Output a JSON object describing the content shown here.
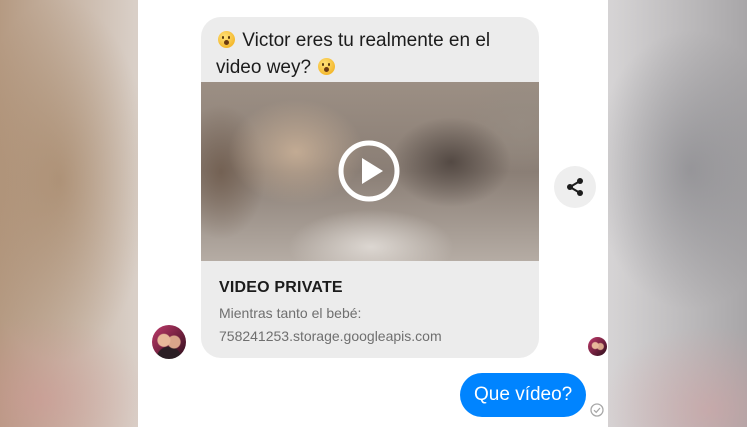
{
  "conversation": {
    "incoming_message": {
      "text_part1": "Victor eres tu realmente en el video wey?",
      "emoji_name": "astonished-face-emoji",
      "link_preview": {
        "title": "VIDEO PRIVATE",
        "subtitle": "Mientras tanto el bebé:",
        "domain": "758241253.storage.googleapis.com"
      }
    },
    "outgoing_message": {
      "text": "Que vídeo?"
    }
  },
  "icons": {
    "play": "play-icon",
    "share": "share-icon",
    "seen": "check-circle-icon"
  },
  "colors": {
    "outgoing_bubble": "#0084ff",
    "incoming_bubble": "#ececec",
    "emoji": "#f4b92f"
  }
}
